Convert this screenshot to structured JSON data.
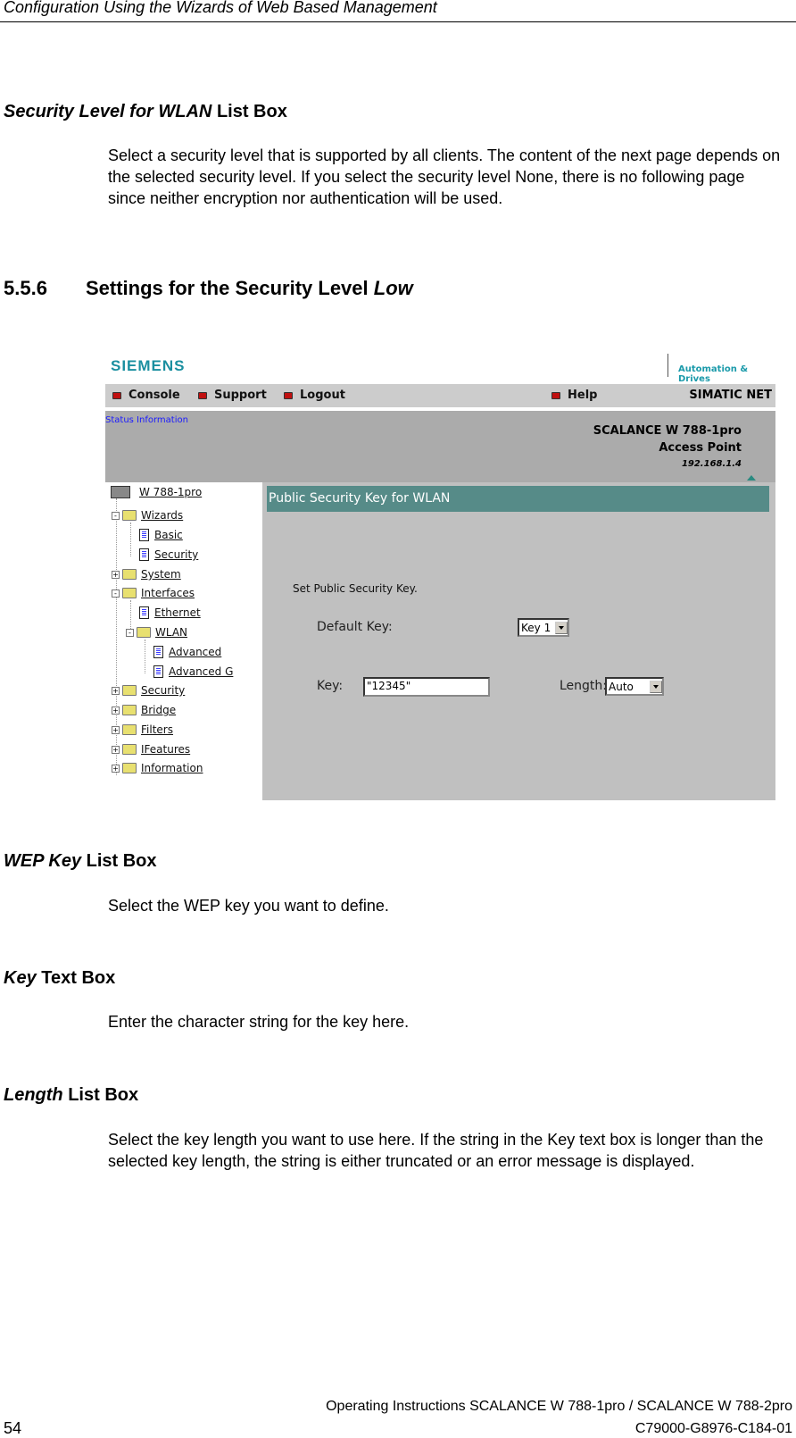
{
  "page": {
    "running_header": "Configuration Using the Wizards of Web Based Management",
    "sections": [
      {
        "title_italic": "Security Level for WLAN",
        "title_rest": " List Box",
        "body": "Select a security level that is supported by all clients. The content of the next page depends on the selected security level. If you select the security level None, there is no following page since neither encryption nor authentication will be used."
      },
      {
        "title_italic": "WEP Key",
        "title_rest": " List Box",
        "body": "Select the WEP key you want to define."
      },
      {
        "title_italic": "Key",
        "title_rest": " Text Box",
        "body": "Enter the character string for the key here."
      },
      {
        "title_italic": "Length",
        "title_rest": " List Box",
        "body": "Select the key length you want to use here. If the string in the Key text box is longer than the selected key length, the string is either truncated or an error message is displayed."
      }
    ],
    "chapter": {
      "number": "5.5.6",
      "title": "Settings for the Security Level ",
      "title_italic": "Low"
    },
    "footer": {
      "line1": "Operating Instructions SCALANCE W 788-1pro / SCALANCE W 788-2pro",
      "line2": "C79000-G8976-C184-01",
      "page_number": "54"
    }
  },
  "screenshot": {
    "logo": "SIEMENS",
    "tagline": "Automation & Drives",
    "menu": [
      "Console",
      "Support",
      "Logout",
      "Help"
    ],
    "brand_right": "SIMATIC NET",
    "status_link": "Status Information",
    "device": {
      "name": "SCALANCE W 788-1pro",
      "mode": "Access Point",
      "ip": "192.168.1.4"
    },
    "tree": [
      {
        "label": "W 788-1pro",
        "icon": "router-icon"
      },
      {
        "label": "Wizards",
        "icon": "folder-open-icon",
        "toggle": "-"
      },
      {
        "label": "Basic",
        "icon": "page-icon"
      },
      {
        "label": "Security",
        "icon": "page-icon"
      },
      {
        "label": "System",
        "icon": "folder-icon",
        "toggle": "+"
      },
      {
        "label": "Interfaces",
        "icon": "folder-open-icon",
        "toggle": "-"
      },
      {
        "label": "Ethernet",
        "icon": "page-icon"
      },
      {
        "label": "WLAN",
        "icon": "folder-open-icon",
        "toggle": "-"
      },
      {
        "label": "Advanced",
        "icon": "page-icon"
      },
      {
        "label": "Advanced G",
        "icon": "page-icon"
      },
      {
        "label": "Security",
        "icon": "folder-icon",
        "toggle": "+"
      },
      {
        "label": "Bridge",
        "icon": "folder-icon",
        "toggle": "+"
      },
      {
        "label": "Filters",
        "icon": "folder-icon",
        "toggle": "+"
      },
      {
        "label": "IFeatures",
        "icon": "folder-icon",
        "toggle": "+"
      },
      {
        "label": "Information",
        "icon": "folder-icon",
        "toggle": "+"
      }
    ],
    "panel": {
      "title": "Public Security Key for WLAN",
      "subtitle": "Set Public Security Key.",
      "default_key_label": "Default Key:",
      "default_key_value": "Key 1",
      "key_label": "Key:",
      "key_value": "\"12345\"",
      "length_label": "Length:",
      "length_value": "Auto"
    },
    "colors": {
      "logo": "#1a8fa0",
      "panel_header": "#568b88",
      "bullet": "#c01010"
    }
  }
}
